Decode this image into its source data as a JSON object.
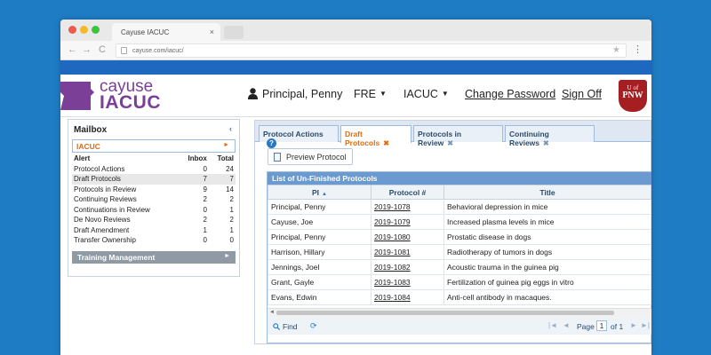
{
  "browser": {
    "tab_title": "Cayuse IACUC",
    "tab_close": "×",
    "url": "cayuse.com/iacuc/",
    "back": "←",
    "forward": "→",
    "reload": "C",
    "star": "★",
    "menu": "⋮"
  },
  "header": {
    "logo_line1": "cayuse",
    "logo_line2": "IACUC",
    "user_name": "Principal, Penny",
    "language": "FRE",
    "module": "IACUC",
    "change_password": "Change Password",
    "sign_off": "Sign Off",
    "crest_line1": "U of",
    "crest_line2": "PNW",
    "accent_color": "#7b3f98",
    "crest_color": "#a51e22"
  },
  "mailbox": {
    "title": "Mailbox",
    "collapse": "‹",
    "section": "IACUC",
    "section_arrow": "►",
    "columns": [
      "Alert",
      "Inbox",
      "Total"
    ],
    "rows": [
      {
        "alert": "Protocol Actions",
        "inbox": "0",
        "total": "24"
      },
      {
        "alert": "Draft Protocols",
        "inbox": "7",
        "total": "7"
      },
      {
        "alert": "Protocols in Review",
        "inbox": "9",
        "total": "14"
      },
      {
        "alert": "Continuing Reviews",
        "inbox": "2",
        "total": "2"
      },
      {
        "alert": "Continuations in Review",
        "inbox": "0",
        "total": "1"
      },
      {
        "alert": "De Novo Reviews",
        "inbox": "2",
        "total": "2"
      },
      {
        "alert": "Draft Amendment",
        "inbox": "1",
        "total": "1"
      },
      {
        "alert": "Transfer Ownership",
        "inbox": "0",
        "total": "0"
      }
    ],
    "training": "Training Management",
    "training_arrow": "►"
  },
  "tabs": [
    {
      "label": "Protocol Actions",
      "help": "?"
    },
    {
      "label": "Draft Protocols",
      "close": "✖"
    },
    {
      "label": "Protocols in Review",
      "close": "✖"
    },
    {
      "label": "Continuing Reviews",
      "close": "✖"
    }
  ],
  "toolbar": {
    "preview_label": "Preview Protocol"
  },
  "grid": {
    "title": "List of Un-Finished Protocols",
    "columns": [
      "PI",
      "Protocol #",
      "Title"
    ],
    "sort_indicator": "▲",
    "rows": [
      {
        "pi": "Principal, Penny",
        "protocol": "2019-1078",
        "title": "Behavioral depression in mice"
      },
      {
        "pi": "Cayuse, Joe",
        "protocol": "2019-1079",
        "title": "Increased plasma levels in mice"
      },
      {
        "pi": "Principal, Penny",
        "protocol": "2019-1080",
        "title": "Prostatic disease in dogs"
      },
      {
        "pi": "Harrison, Hillary",
        "protocol": "2019-1081",
        "title": "Radiotherapy of tumors in dogs"
      },
      {
        "pi": "Jennings, Joel",
        "protocol": "2019-1082",
        "title": "Acoustic trauma in the guinea pig"
      },
      {
        "pi": "Grant, Gayle",
        "protocol": "2019-1083",
        "title": "Fertilization of guinea pig eggs in vitro"
      },
      {
        "pi": "Evans, Edwin",
        "protocol": "2019-1084",
        "title": "Anti-cell antibody in macaques."
      }
    ]
  },
  "pager": {
    "find": "Find",
    "reload": "⟳",
    "first": "|◄",
    "prev": "◄",
    "page_label": "Page",
    "page": "1",
    "of_label": "of 1",
    "next": "►",
    "last": "►|"
  }
}
